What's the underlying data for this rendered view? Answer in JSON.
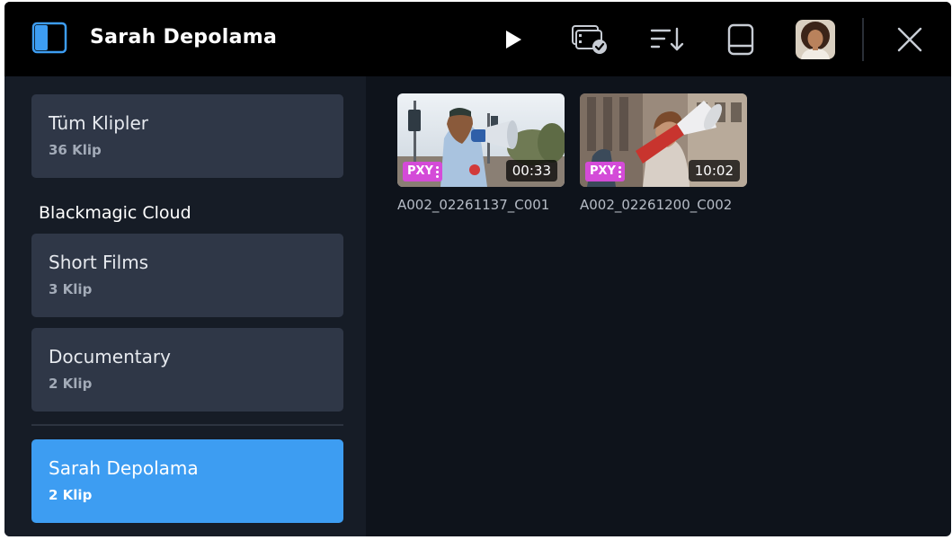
{
  "colors": {
    "accent": "#3d9df2",
    "proxy_badge": "#d44bd8",
    "card": "#2f3747",
    "sidebar": "#161c26",
    "content": "#0e131b",
    "topbar": "#000000"
  },
  "header": {
    "title": "Sarah Depolama",
    "icons": [
      "sidebar-toggle-icon",
      "play-icon",
      "clip-check-icon",
      "sort-icon",
      "drive-icon",
      "avatar",
      "close-icon"
    ]
  },
  "sidebar": {
    "all_clips": {
      "name": "Tüm Klipler",
      "count": "36 Klip"
    },
    "section_title": "Blackmagic Cloud",
    "projects": [
      {
        "name": "Short Films",
        "count": "3 Klip"
      },
      {
        "name": "Documentary",
        "count": "2 Klip"
      }
    ],
    "storage": {
      "name": "Sarah Depolama",
      "count": "2 Klip",
      "selected": true
    }
  },
  "clips": [
    {
      "name": "A002_02261137_C001",
      "badge": "PXY",
      "duration": "00:33"
    },
    {
      "name": "A002_02261200_C002",
      "badge": "PXY",
      "duration": "10:02"
    }
  ]
}
